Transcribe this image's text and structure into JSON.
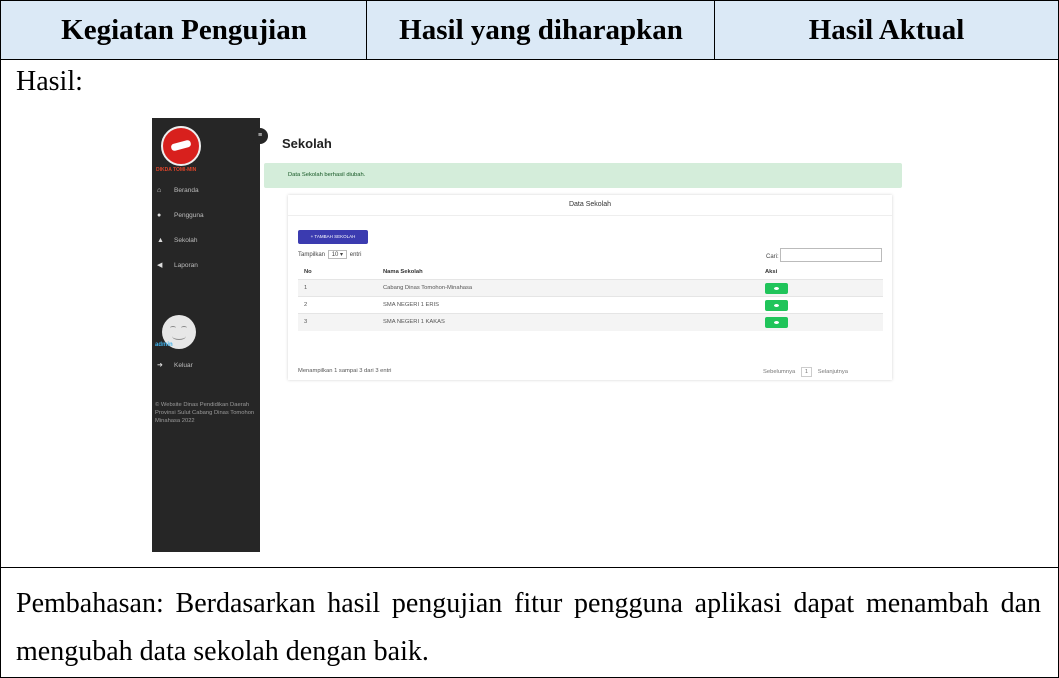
{
  "table": {
    "headers": [
      "Kegiatan Pengujian",
      "Hasil yang diharapkan",
      "Hasil Aktual"
    ],
    "result_label": "Hasil:",
    "discussion": "Pembahasan: Berdasarkan hasil pengujian fitur pengguna aplikasi dapat menambah dan mengubah data sekolah dengan baik."
  },
  "screenshot": {
    "brand": "DIKDA TOMI-MIN",
    "sidebar": {
      "items": [
        {
          "label": "Beranda",
          "icon": "home-icon"
        },
        {
          "label": "Pengguna",
          "icon": "user-icon"
        },
        {
          "label": "Sekolah",
          "icon": "school-icon"
        },
        {
          "label": "Laporan",
          "icon": "send-icon"
        }
      ],
      "user": "admin",
      "logout": "Keluar",
      "copyright": "© Website Dinas Pendidikan Daerah Provinsi Sulut Cabang Dinas Tomohon Minahasa 2022"
    },
    "page_title": "Sekolah",
    "alert": "Data Sekolah berhasil diubah.",
    "card_title": "Data Sekolah",
    "add_button": "+ TAMBAH SEKOLAH",
    "length": {
      "prefix": "Tampilkan",
      "value": "10",
      "suffix": "entri"
    },
    "search_label": "Cari:",
    "columns": [
      "No",
      "Nama Sekolah",
      "Aksi"
    ],
    "rows": [
      {
        "no": "1",
        "name": "Cabang Dinas Tomohon-Minahasa"
      },
      {
        "no": "2",
        "name": "SMA NEGERI 1 ERIS"
      },
      {
        "no": "3",
        "name": "SMA NEGERI 1 KAKAS"
      }
    ],
    "info": "Menampilkan 1 sampai 3 dari 3 entri",
    "pager": {
      "prev": "Sebelumnya",
      "page": "1",
      "next": "Selanjutnya"
    }
  }
}
